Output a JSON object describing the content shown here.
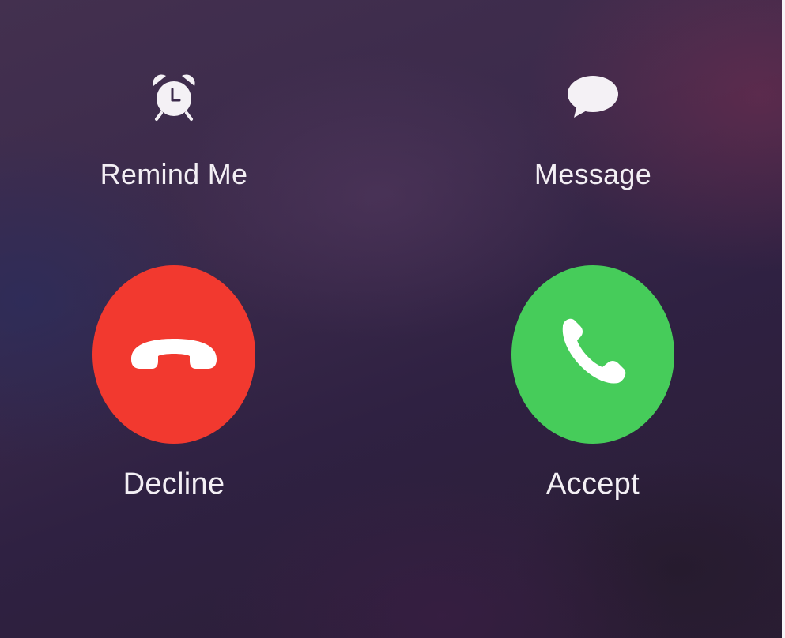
{
  "quick_actions": {
    "remind": {
      "label": "Remind Me",
      "icon": "alarm-clock-icon"
    },
    "message": {
      "label": "Message",
      "icon": "speech-bubble-icon"
    }
  },
  "call_controls": {
    "decline": {
      "label": "Decline",
      "icon": "phone-hangup-icon",
      "color": "#f2392f"
    },
    "accept": {
      "label": "Accept",
      "icon": "phone-icon",
      "color": "#46cc5a"
    }
  }
}
